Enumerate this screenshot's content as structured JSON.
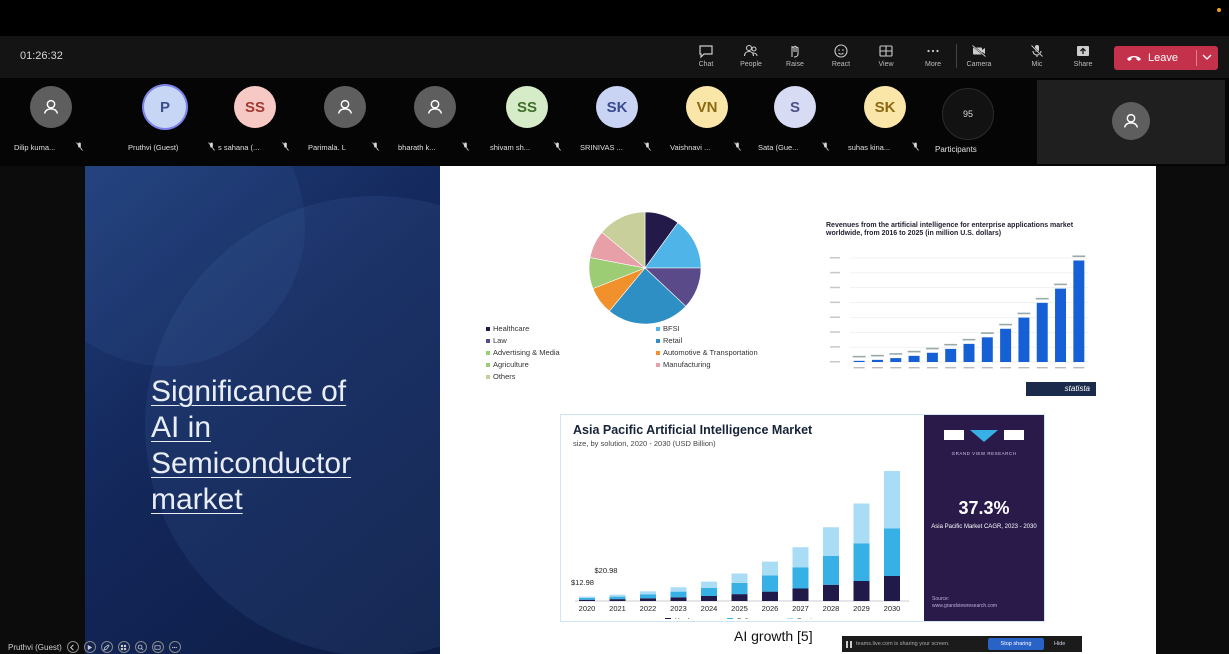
{
  "meeting": {
    "timer": "01:26:32"
  },
  "toolbar": {
    "buttons": [
      {
        "id": "chat",
        "label": "Chat",
        "icon": "chat-icon"
      },
      {
        "id": "people",
        "label": "People",
        "icon": "people-icon"
      },
      {
        "id": "raise",
        "label": "Raise",
        "icon": "raise-hand-icon"
      },
      {
        "id": "react",
        "label": "React",
        "icon": "react-icon"
      },
      {
        "id": "view",
        "label": "View",
        "icon": "view-icon"
      },
      {
        "id": "more",
        "label": "More",
        "icon": "more-icon"
      },
      {
        "id": "camera",
        "label": "Camera",
        "icon": "camera-off-icon"
      },
      {
        "id": "mic",
        "label": "Mic",
        "icon": "mic-off-icon"
      },
      {
        "id": "share",
        "label": "Share",
        "icon": "share-icon"
      }
    ],
    "leave_label": "Leave"
  },
  "participants": [
    {
      "initials": "",
      "name": "Dilip kuma...",
      "bg": "#5e5e5e",
      "fg": "#fff",
      "gray": true
    },
    {
      "initials": "P",
      "name": "Pruthvi (Guest)",
      "bg": "#c7d6f5",
      "fg": "#3b4f8f",
      "ring": true
    },
    {
      "initials": "SS",
      "name": "s sahana (...",
      "bg": "#f6c9c4",
      "fg": "#a33b33"
    },
    {
      "initials": "",
      "name": "Parimala. L",
      "bg": "#5e5e5e",
      "fg": "#fff",
      "gray": true
    },
    {
      "initials": "",
      "name": "bharath k...",
      "bg": "#5e5e5e",
      "fg": "#fff",
      "gray": true
    },
    {
      "initials": "SS",
      "name": "shivam sh...",
      "bg": "#d6ecc8",
      "fg": "#3f6f2a"
    },
    {
      "initials": "SK",
      "name": "SRINIVAS ...",
      "bg": "#c9d3f3",
      "fg": "#3a4b8f"
    },
    {
      "initials": "VN",
      "name": "Vaishnavi ...",
      "bg": "#fae6a8",
      "fg": "#8a6a10"
    },
    {
      "initials": "S",
      "name": "Sata (Gue...",
      "bg": "#d7dbf3",
      "fg": "#4a528a"
    },
    {
      "initials": "SK",
      "name": "suhas kina...",
      "bg": "#fae6a8",
      "fg": "#8a6a10"
    }
  ],
  "participants_count": "95",
  "participants_label": "Participants",
  "slide": {
    "title_lines": [
      "Significance of",
      "AI in",
      "Semiconductor",
      "market"
    ],
    "pie": {
      "slices": [
        {
          "value": 10,
          "color": "#241a4a"
        },
        {
          "value": 15,
          "color": "#4fb5e8"
        },
        {
          "value": 12,
          "color": "#5a4a8a"
        },
        {
          "value": 24,
          "color": "#2e8fc4"
        },
        {
          "value": 8,
          "color": "#f0912c"
        },
        {
          "value": 9,
          "color": "#9ccc74"
        },
        {
          "value": 8,
          "color": "#e8a0a8"
        },
        {
          "value": 14,
          "color": "#c8cf9a"
        }
      ],
      "legend": [
        {
          "label": "Healthcare",
          "color": "#241a4a"
        },
        {
          "label": "BFSI",
          "color": "#4fb5e8"
        },
        {
          "label": "Law",
          "color": "#5a4a8a"
        },
        {
          "label": "Retail",
          "color": "#2e8fc4"
        },
        {
          "label": "Advertising & Media",
          "color": "#9ccc74"
        },
        {
          "label": "Automotive & Transportation",
          "color": "#f0912c"
        },
        {
          "label": "Agriculture",
          "color": "#9ccc74"
        },
        {
          "label": "Manufacturing",
          "color": "#e8a0a8"
        },
        {
          "label": "Others",
          "color": "#c8cf9a"
        }
      ]
    },
    "statista": {
      "title": "Revenues from the artificial intelligence for enterprise applications market worldwide, from 2016 to 2025 (in million U.S. dollars)",
      "badge": "statista",
      "values": [
        358,
        660,
        1198,
        1901,
        2840,
        4035,
        5581,
        7595,
        10220,
        13651,
        18193,
        22578,
        31236
      ]
    },
    "gvr": {
      "title": "Asia Pacific Artificial Intelligence Market",
      "subtitle": "size, by solution, 2020 - 2030 (USD Billion)",
      "years": [
        "2020",
        "2021",
        "2022",
        "2023",
        "2024",
        "2025",
        "2026",
        "2027",
        "2028",
        "2029",
        "2030"
      ],
      "hardware": [
        1,
        1.5,
        2.2,
        3,
        4,
        5.5,
        7.5,
        10,
        13,
        16,
        20
      ],
      "software": [
        1.5,
        2,
        3,
        4.5,
        6.5,
        9,
        13,
        17,
        23,
        30,
        38
      ],
      "services": [
        1,
        1.5,
        2.5,
        3.5,
        5,
        7.5,
        11,
        16,
        23,
        32,
        46
      ],
      "label_2020": "$12.98",
      "label_2021": "$20.98",
      "legend": [
        "Hardware",
        "Software",
        "Services"
      ],
      "colors": {
        "hardware": "#1f1a4a",
        "software": "#37b0e6",
        "services": "#a9dcf5"
      },
      "cagr": "37.3%",
      "cagr_label": "Asia Pacific Market CAGR, 2023 - 2030",
      "brand": "GRAND VIEW RESEARCH",
      "source_label": "Source:",
      "source_url": "www.grandviewresearch.com"
    },
    "caption": "AI growth [5]"
  },
  "sharebar": {
    "message": "teams.live.com is sharing your screen.",
    "stop": "Stop sharing",
    "hide": "Hide"
  },
  "presenter": "Pruthvi (Guest)"
}
